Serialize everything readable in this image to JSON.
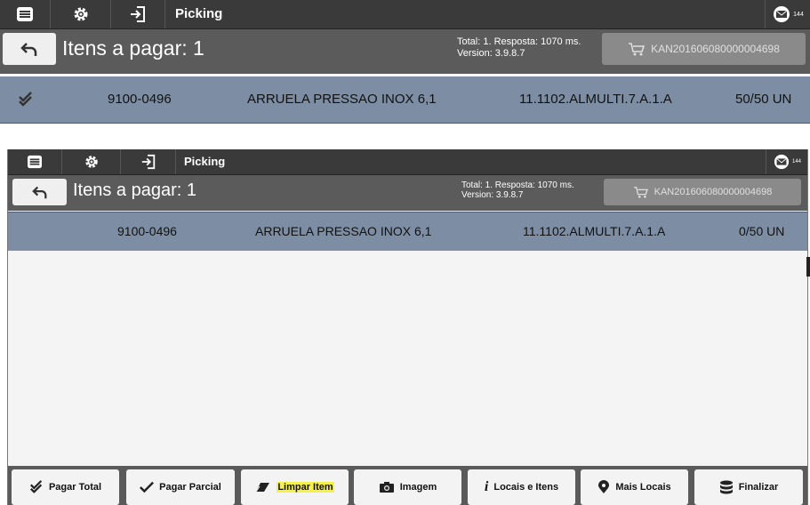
{
  "screens": [
    {
      "topbar": {
        "title": "Picking",
        "mail_count": "144"
      },
      "header": {
        "title": "Itens a pagar: 1",
        "total_line": "Total: 1. Resposta: 1070 ms.",
        "version_line": "Version: 3.9.8.7",
        "kanban": "KAN201606080000004698"
      },
      "row": {
        "code": "9100-0496",
        "description": "ARRUELA PRESSAO INOX  6,1",
        "location": "11.1102.ALMULTI.7.A.1.A",
        "quantity": "50/50 UN",
        "checked": true
      }
    },
    {
      "topbar": {
        "title": "Picking",
        "mail_count": "144"
      },
      "header": {
        "title": "Itens a pagar: 1",
        "total_line": "Total: 1. Resposta: 1070 ms.",
        "version_line": "Version: 3.9.8.7",
        "kanban": "KAN201606080000004698"
      },
      "row": {
        "code": "9100-0496",
        "description": "ARRUELA PRESSAO INOX  6,1",
        "location": "11.1102.ALMULTI.7.A.1.A",
        "quantity": "0/50 UN",
        "checked": false
      },
      "buttons": [
        {
          "label": "Pagar Total",
          "icon": "double-check-icon"
        },
        {
          "label": "Pagar Parcial",
          "icon": "check-icon"
        },
        {
          "label": "Limpar Item",
          "icon": "eraser-icon",
          "highlighted": true
        },
        {
          "label": "Imagem",
          "icon": "camera-icon"
        },
        {
          "label": "Locais e Itens",
          "icon": "info-icon"
        },
        {
          "label": "Mais Locais",
          "icon": "map-pin-icon"
        },
        {
          "label": "Finalizar",
          "icon": "database-icon"
        }
      ]
    }
  ],
  "colors": {
    "topbar": "#3a3a3a",
    "header": "#5b5b5b",
    "row": "#7d8ea4",
    "highlight": "#f6f04a"
  }
}
